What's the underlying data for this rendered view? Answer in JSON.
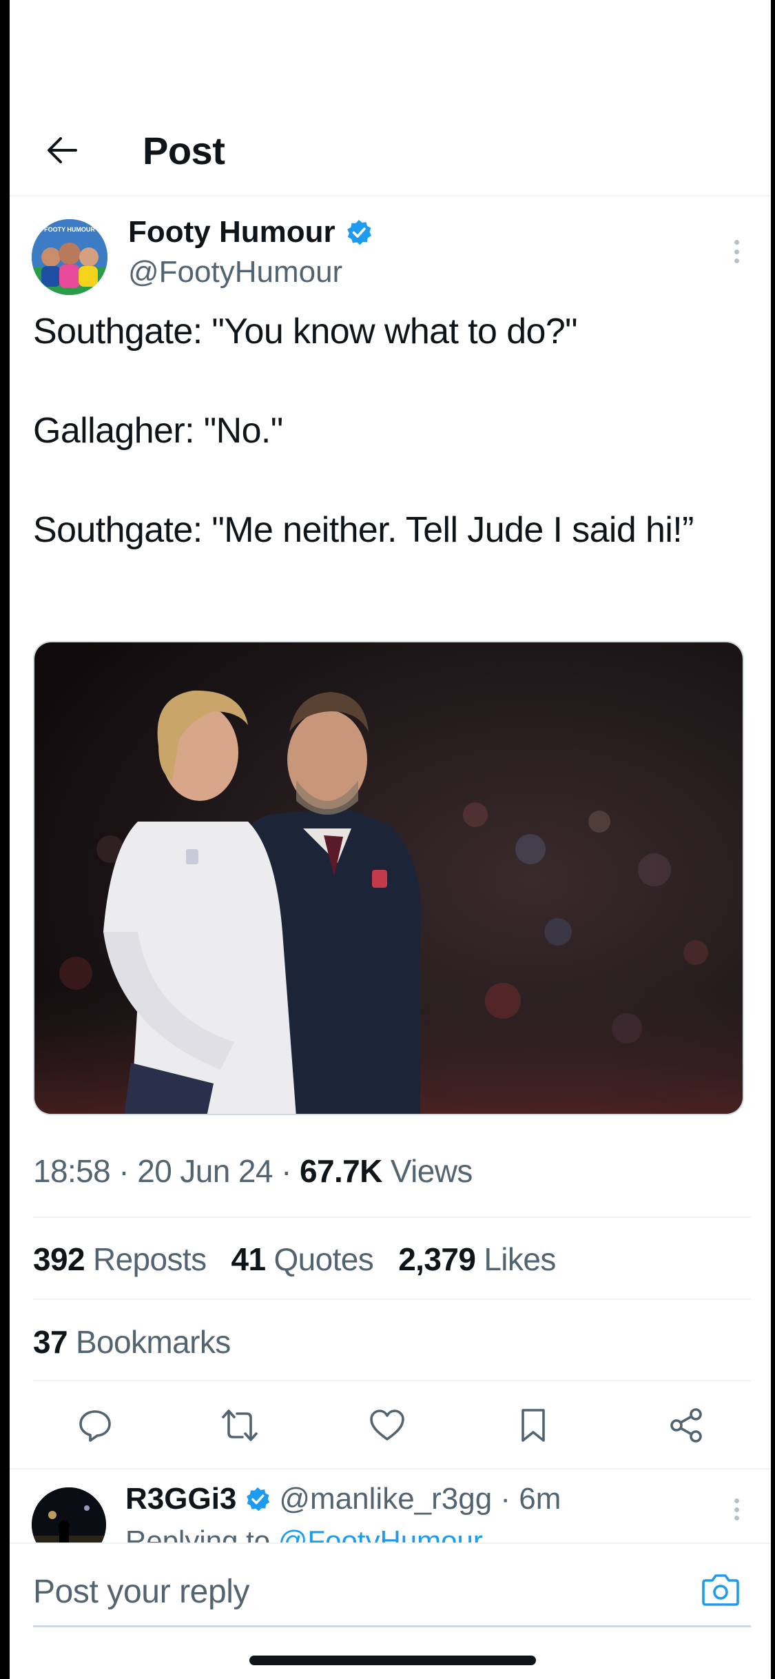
{
  "header": {
    "title": "Post"
  },
  "author": {
    "name": "Footy Humour",
    "handle": "@FootyHumour",
    "avatar_badge": "FOOTY HUMOUR"
  },
  "tweet": {
    "line1": "Southgate: \"You know what to do?\"",
    "line2": "Gallagher: \"No.\"",
    "line3": "Southgate: \"Me neither. Tell Jude I said hi!”"
  },
  "meta": {
    "time": "18:58",
    "date": "20 Jun 24",
    "views_count": "67.7K",
    "views_label": "Views",
    "separator": "·"
  },
  "stats": {
    "reposts_count": "392",
    "reposts_label": "Reposts",
    "quotes_count": "41",
    "quotes_label": "Quotes",
    "likes_count": "2,379",
    "likes_label": "Likes",
    "bookmarks_count": "37",
    "bookmarks_label": "Bookmarks"
  },
  "actions": [
    "reply-icon",
    "repost-icon",
    "like-icon",
    "bookmark-icon",
    "share-icon"
  ],
  "reply": {
    "name": "R3GGi3",
    "handle_time": "@manlike_r3gg · 6m",
    "replying_prefix": "Replying to ",
    "replying_to": "@FootyHumour"
  },
  "composer": {
    "placeholder": "Post your reply"
  },
  "colors": {
    "accent": "#1d9bf0",
    "text": "#0f1419",
    "muted": "#536471",
    "divider": "#eff3f4"
  }
}
